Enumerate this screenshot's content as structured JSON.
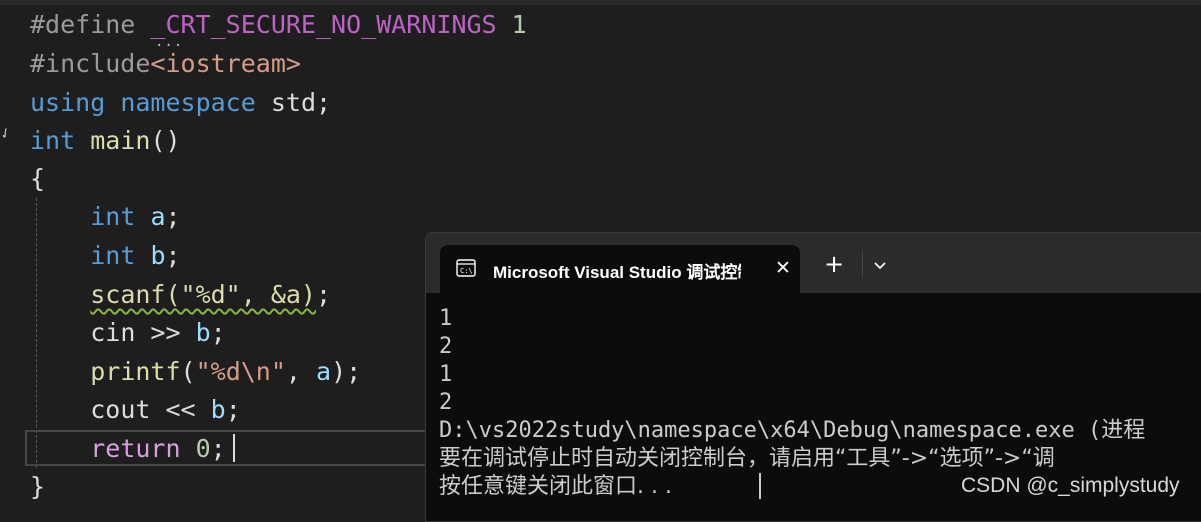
{
  "editor": {
    "lines": [
      {
        "segments": [
          {
            "t": "#define ",
            "c": "c-pre"
          },
          {
            "t": "_CRT_SECURE_NO_WARNINGS",
            "c": "c-macro"
          },
          {
            "t": " 1",
            "c": "c-num"
          }
        ]
      },
      {
        "segments": [
          {
            "t": "#include",
            "c": "c-pre"
          },
          {
            "t": "<iostream>",
            "c": "c-str"
          }
        ]
      },
      {
        "segments": [
          {
            "t": "using",
            "c": "c-kw"
          },
          {
            "t": " ",
            "c": "c-id"
          },
          {
            "t": "namespace",
            "c": "c-kw"
          },
          {
            "t": " std;",
            "c": "c-id"
          }
        ]
      },
      {
        "segments": [
          {
            "t": "int",
            "c": "c-kw"
          },
          {
            "t": " ",
            "c": "c-id"
          },
          {
            "t": "main",
            "c": "c-fn"
          },
          {
            "t": "()",
            "c": "c-punc"
          }
        ]
      },
      {
        "segments": [
          {
            "t": "{",
            "c": "c-punc"
          }
        ]
      },
      {
        "segments": [
          {
            "t": "    ",
            "c": "c-id"
          },
          {
            "t": "int",
            "c": "c-kw"
          },
          {
            "t": " ",
            "c": "c-id"
          },
          {
            "t": "a",
            "c": "c-var"
          },
          {
            "t": ";",
            "c": "c-punc"
          }
        ]
      },
      {
        "segments": [
          {
            "t": "    ",
            "c": "c-id"
          },
          {
            "t": "int",
            "c": "c-kw"
          },
          {
            "t": " ",
            "c": "c-id"
          },
          {
            "t": "b",
            "c": "c-var"
          },
          {
            "t": ";",
            "c": "c-punc"
          }
        ]
      },
      {
        "segments": [
          {
            "t": "    ",
            "c": "c-id"
          },
          {
            "t": "scanf(\"%d\", &a)",
            "c": "c-fn",
            "squiggle": true
          },
          {
            "t": ";",
            "c": "c-punc"
          }
        ]
      },
      {
        "segments": [
          {
            "t": "    ",
            "c": "c-id"
          },
          {
            "t": "cin",
            "c": "c-id"
          },
          {
            "t": " >> ",
            "c": "c-punc"
          },
          {
            "t": "b",
            "c": "c-var"
          },
          {
            "t": ";",
            "c": "c-punc"
          }
        ]
      },
      {
        "segments": [
          {
            "t": "    ",
            "c": "c-id"
          },
          {
            "t": "printf",
            "c": "c-fn"
          },
          {
            "t": "(",
            "c": "c-punc"
          },
          {
            "t": "\"%d\\n\"",
            "c": "c-str"
          },
          {
            "t": ", ",
            "c": "c-punc"
          },
          {
            "t": "a",
            "c": "c-var"
          },
          {
            "t": ");",
            "c": "c-punc"
          }
        ]
      },
      {
        "segments": [
          {
            "t": "    ",
            "c": "c-id"
          },
          {
            "t": "cout",
            "c": "c-id"
          },
          {
            "t": " << ",
            "c": "c-punc"
          },
          {
            "t": "b",
            "c": "c-var"
          },
          {
            "t": ";",
            "c": "c-punc"
          }
        ]
      },
      {
        "segments": [
          {
            "t": "    ",
            "c": "c-id"
          },
          {
            "t": "return",
            "c": "c-ctl"
          },
          {
            "t": " ",
            "c": "c-id"
          },
          {
            "t": "0",
            "c": "c-num"
          },
          {
            "t": ";",
            "c": "c-punc"
          }
        ]
      },
      {
        "segments": [
          {
            "t": "}",
            "c": "c-punc"
          }
        ]
      }
    ]
  },
  "console": {
    "tab_title": "Microsoft Visual Studio 调试控制台",
    "close_label": "✕",
    "new_tab_label": "+",
    "output": [
      "1",
      "2",
      "1",
      "2",
      "D:\\vs2022study\\namespace\\x64\\Debug\\namespace.exe (进程",
      "要在调试停止时自动关闭控制台，请启用“工具”->“选项”->“调",
      "按任意键关闭此窗口. . ."
    ]
  },
  "watermark": "CSDN @c_simplystudy",
  "colors": {
    "editor_bg": "#1e1e1e",
    "console_bg": "#0c0c0c",
    "titlebar_bg": "#2b2b2b",
    "keyword": "#569cd6",
    "function": "#dcdcaa",
    "string": "#d69d85",
    "macro": "#bd63c5",
    "control": "#d8a0df"
  }
}
